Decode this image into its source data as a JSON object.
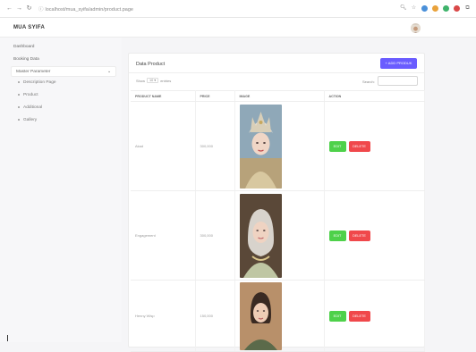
{
  "browser": {
    "url": "localhost/mua_syifa/admin/product.page",
    "back": "←",
    "forward": "→",
    "reload": "↻"
  },
  "app": {
    "brand": "MUA SYIFA"
  },
  "sidebar": {
    "items": [
      "Dashboard",
      "Booking Data"
    ],
    "dropdown": {
      "label": "Master Parameter",
      "caret": "⌄"
    },
    "subitems": [
      "Description Page",
      "Product",
      "Additional",
      "Gallery"
    ]
  },
  "card": {
    "title": "Data Product",
    "add_button": "+ ADD PRODUK",
    "show_label": "Show",
    "show_value": "10 ▾",
    "entries_label": "entries",
    "search_label": "Search:"
  },
  "table": {
    "headers": [
      "PRODUCT NAME",
      "PRICE",
      "IMAGE",
      "ACTION"
    ],
    "rows": [
      {
        "name": "Akad",
        "price": "300,000"
      },
      {
        "name": "Engagement",
        "price": "300,000"
      },
      {
        "name": "Henny Wisp",
        "price": "150,000"
      }
    ],
    "edit_label": "EDIT",
    "delete_label": "DELETE"
  },
  "colors": {
    "accent": "#6a5cff",
    "edit": "#4ed14a",
    "delete": "#f0484b"
  }
}
